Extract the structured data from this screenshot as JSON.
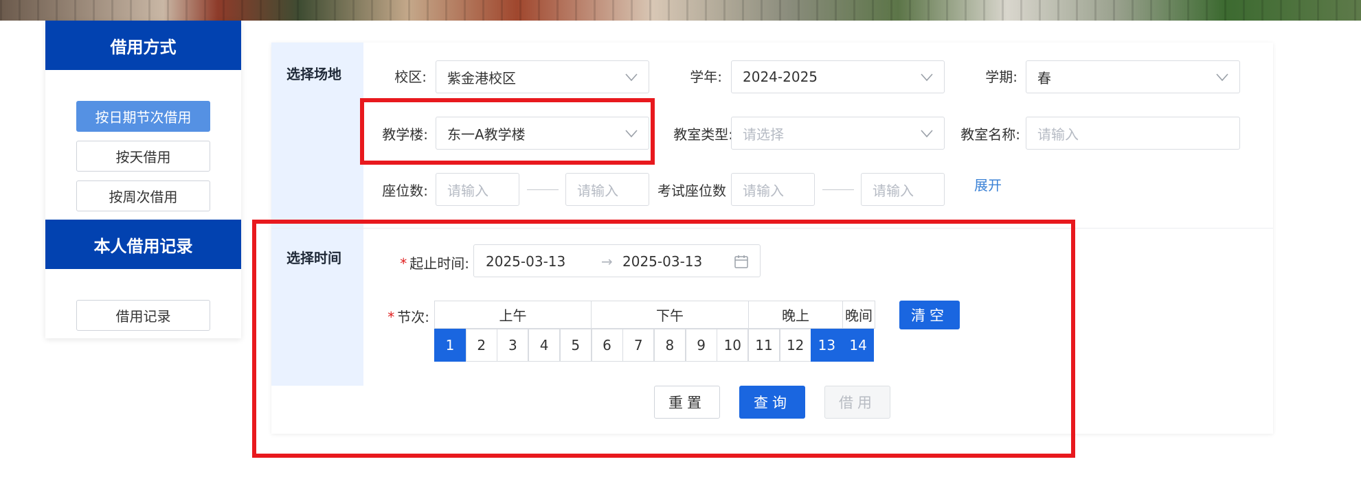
{
  "sidebar": {
    "borrow_mode_title": "借用方式",
    "modes": [
      {
        "label": "按日期节次借用",
        "active": true
      },
      {
        "label": "按天借用",
        "active": false
      },
      {
        "label": "按周次借用",
        "active": false
      }
    ],
    "records_title": "本人借用记录",
    "records_button": "借用记录"
  },
  "venue": {
    "section_title": "选择场地",
    "campus_label": "校区:",
    "campus_value": "紫金港校区",
    "year_label": "学年:",
    "year_value": "2024-2025",
    "term_label": "学期:",
    "term_value": "春",
    "building_label": "教学楼:",
    "building_value": "东一A教学楼",
    "room_type_label": "教室类型:",
    "room_type_placeholder": "请选择",
    "room_name_label": "教室名称:",
    "room_name_placeholder": "请输入",
    "seats_label": "座位数:",
    "seats_min_placeholder": "请输入",
    "seats_max_placeholder": "请输入",
    "exam_seats_label": "考试座位数",
    "exam_seats_min_placeholder": "请输入",
    "exam_seats_max_placeholder": "请输入",
    "expand_link": "展开"
  },
  "time": {
    "section_title": "选择时间",
    "required_mark": "*",
    "date_range_label": "起止时间:",
    "start_date": "2025-03-13",
    "range_arrow": "→",
    "end_date": "2025-03-13",
    "periods_label": "节次:",
    "groups": [
      "上午",
      "下午",
      "晚上",
      "晚间"
    ],
    "periods": [
      {
        "label": "1",
        "selected": true
      },
      {
        "label": "2",
        "selected": false
      },
      {
        "label": "3",
        "selected": false
      },
      {
        "label": "4",
        "selected": false
      },
      {
        "label": "5",
        "selected": false
      },
      {
        "label": "6",
        "selected": false
      },
      {
        "label": "7",
        "selected": false
      },
      {
        "label": "8",
        "selected": false
      },
      {
        "label": "9",
        "selected": false
      },
      {
        "label": "10",
        "selected": false
      },
      {
        "label": "11",
        "selected": false
      },
      {
        "label": "12",
        "selected": false
      },
      {
        "label": "13",
        "selected": true
      },
      {
        "label": "14",
        "selected": true
      }
    ],
    "clear_button": "清空"
  },
  "actions": {
    "reset": "重置",
    "query": "查询",
    "borrow": "借用"
  },
  "colors": {
    "primary": "#1a66e0",
    "sidebar_header": "#0242b0",
    "highlight": "#e8191e",
    "label_bg": "#eaf2ff"
  }
}
